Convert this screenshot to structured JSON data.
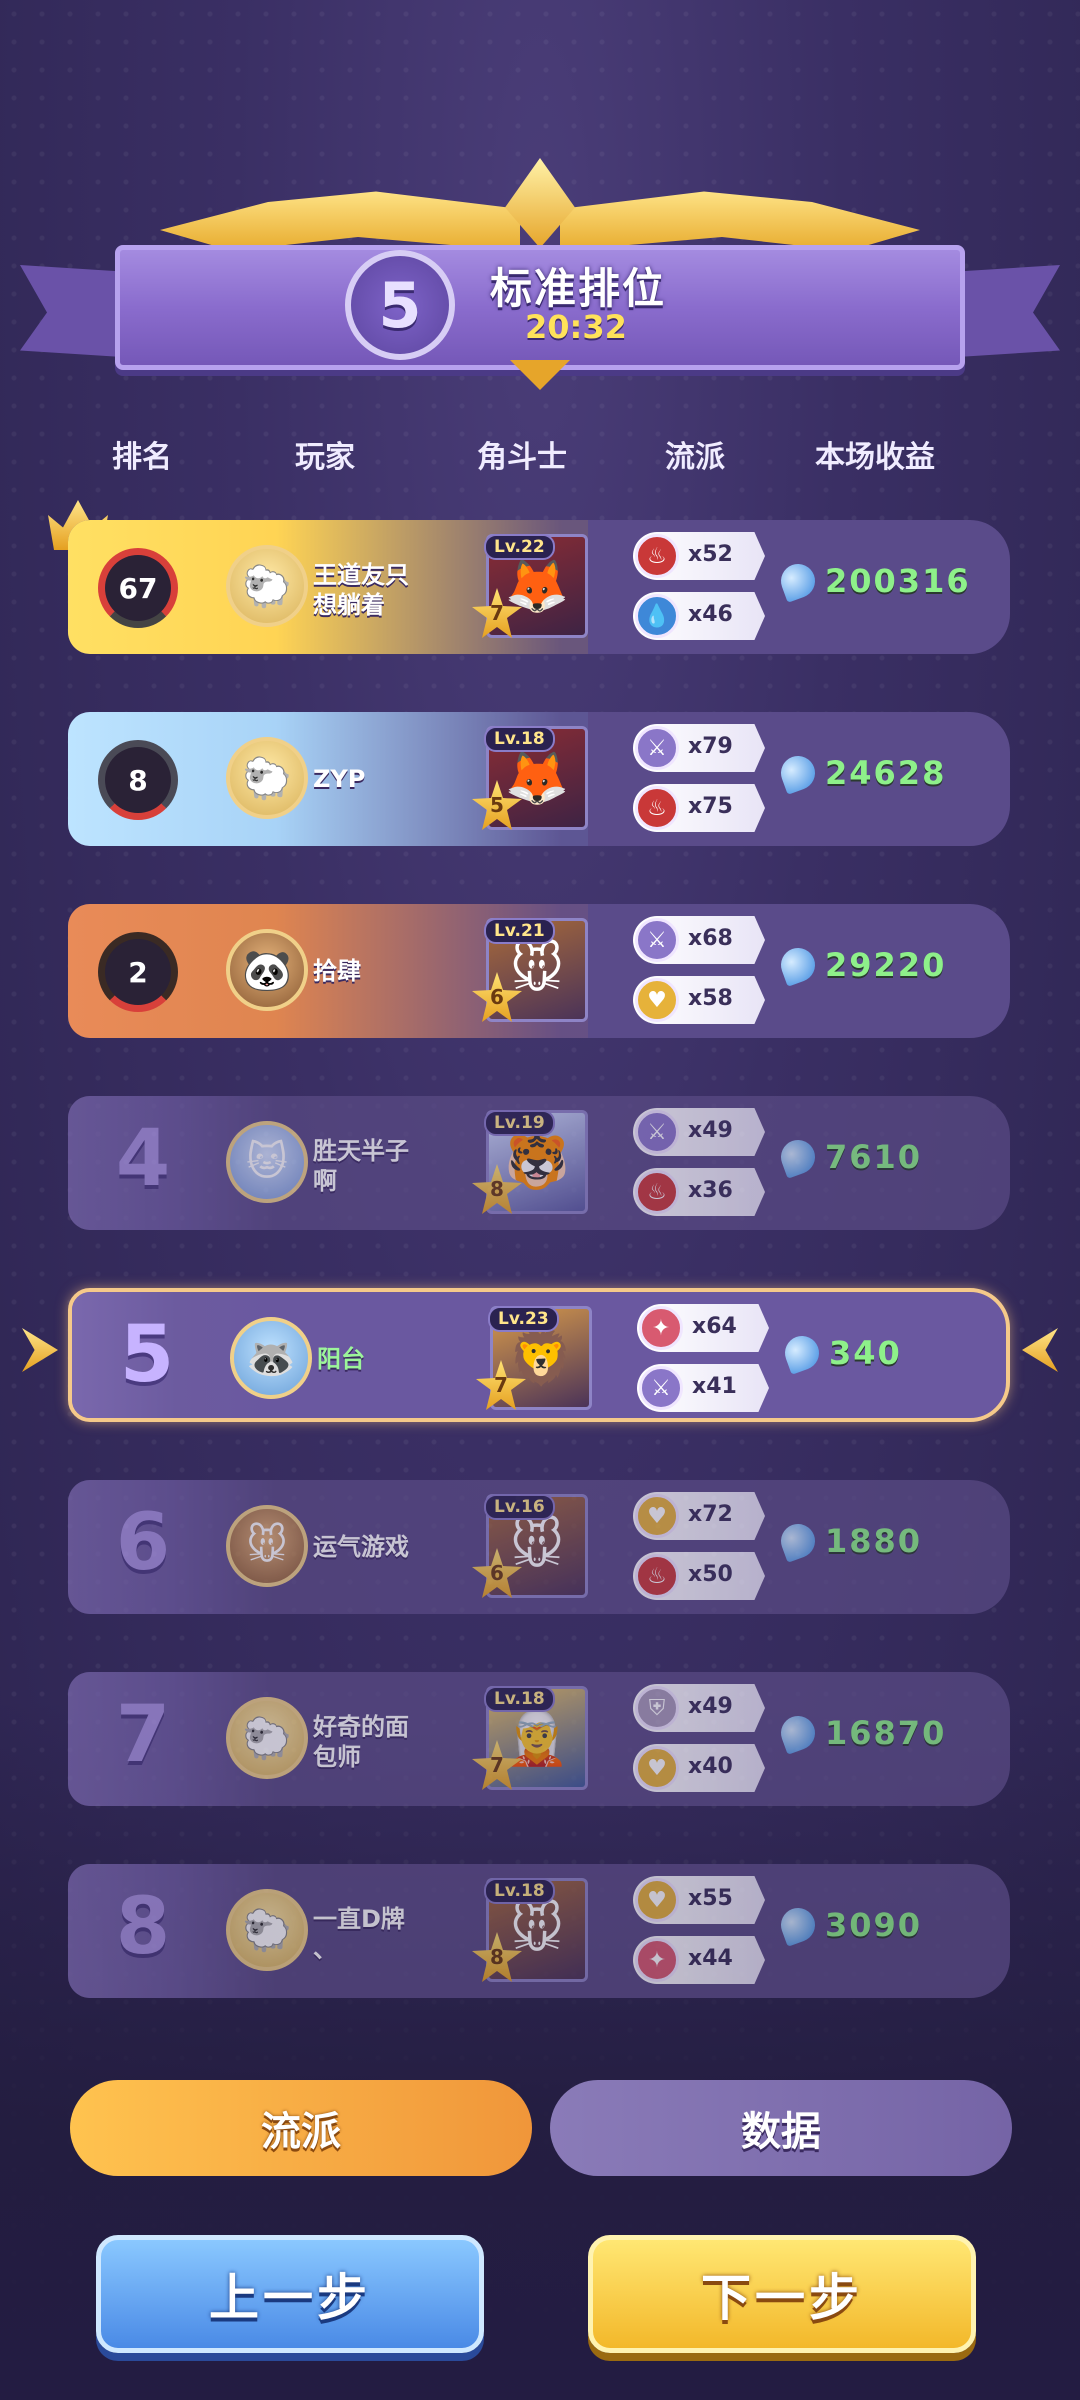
{
  "header": {
    "rank_badge": "5",
    "mode_title": "标准排位",
    "time": "20:32"
  },
  "columns": {
    "rank": "排名",
    "player": "玩家",
    "champion": "角斗士",
    "trait": "流派",
    "earnings": "本场收益"
  },
  "rows": [
    {
      "rank": "67",
      "player": "王道友只\n想躺着",
      "level": "Lv.22",
      "stars": "7",
      "trait1": {
        "icon": "fire-icon",
        "count": "x52"
      },
      "trait2": {
        "icon": "water-icon",
        "count": "x46"
      },
      "earnings": "200316"
    },
    {
      "rank": "8",
      "player": "ZYP",
      "level": "Lv.18",
      "stars": "5",
      "trait1": {
        "icon": "sword-icon",
        "count": "x79"
      },
      "trait2": {
        "icon": "fire-icon",
        "count": "x75"
      },
      "earnings": "24628"
    },
    {
      "rank": "2",
      "player": "拾肆",
      "level": "Lv.21",
      "stars": "6",
      "trait1": {
        "icon": "sword-icon",
        "count": "x68"
      },
      "trait2": {
        "icon": "heart-icon",
        "count": "x58"
      },
      "earnings": "29220"
    },
    {
      "rank": "4",
      "player": "胜天半子\n啊",
      "level": "Lv.19",
      "stars": "8",
      "trait1": {
        "icon": "sword-icon",
        "count": "x49"
      },
      "trait2": {
        "icon": "fire-icon",
        "count": "x36"
      },
      "earnings": "7610"
    },
    {
      "rank": "5",
      "player": "阳台",
      "level": "Lv.23",
      "stars": "7",
      "trait1": {
        "icon": "flame-icon",
        "count": "x64"
      },
      "trait2": {
        "icon": "sword-icon",
        "count": "x41"
      },
      "earnings": "340"
    },
    {
      "rank": "6",
      "player": "运气游戏",
      "level": "Lv.16",
      "stars": "6",
      "trait1": {
        "icon": "heart-icon",
        "count": "x72"
      },
      "trait2": {
        "icon": "fire-icon",
        "count": "x50"
      },
      "earnings": "1880"
    },
    {
      "rank": "7",
      "player": "好奇的面\n包师",
      "level": "Lv.18",
      "stars": "7",
      "trait1": {
        "icon": "shield-icon",
        "count": "x49"
      },
      "trait2": {
        "icon": "heart-icon",
        "count": "x40"
      },
      "earnings": "16870"
    },
    {
      "rank": "8",
      "player": "一直D牌\n、",
      "level": "Lv.18",
      "stars": "8",
      "trait1": {
        "icon": "heart-icon",
        "count": "x55"
      },
      "trait2": {
        "icon": "flame-icon",
        "count": "x44"
      },
      "earnings": "3090"
    }
  ],
  "tabs": {
    "trait": "流派",
    "data": "数据"
  },
  "buttons": {
    "prev": "上一步",
    "next": "下一步"
  }
}
